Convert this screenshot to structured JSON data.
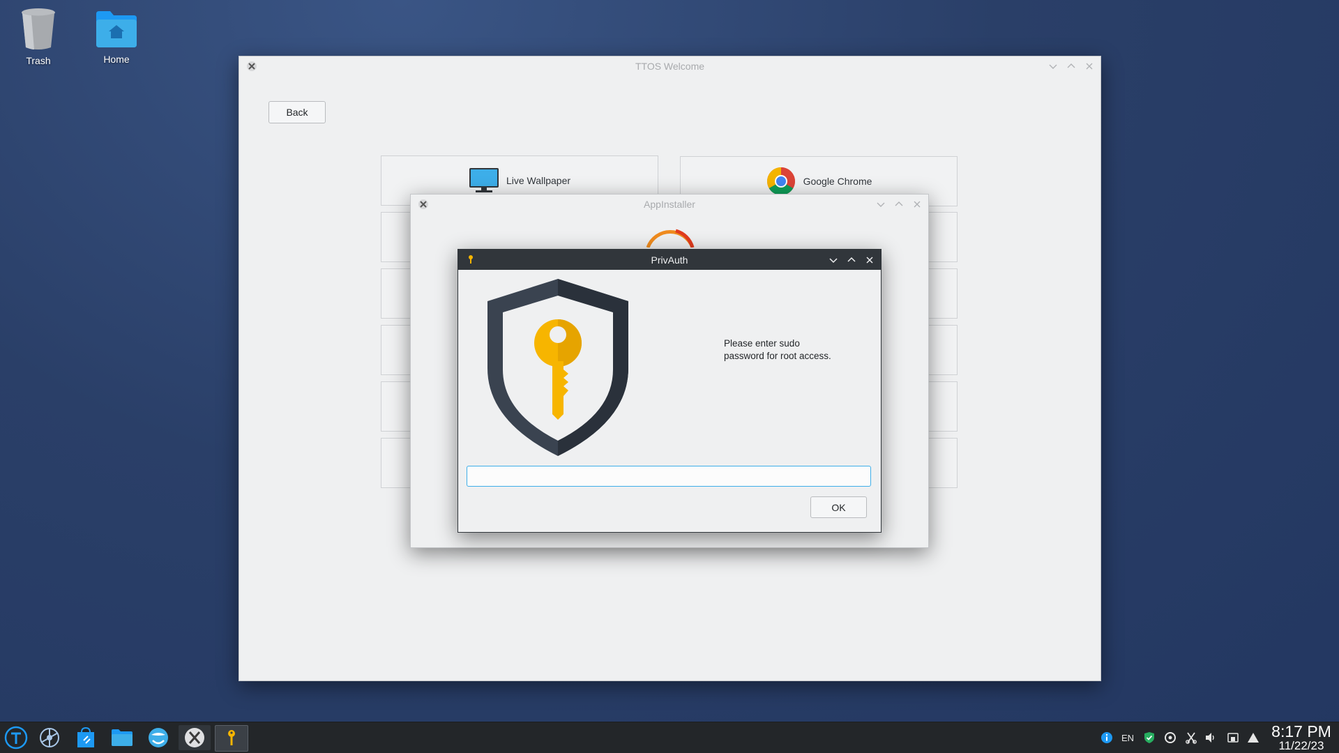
{
  "desktop": {
    "icons": [
      {
        "label": "Trash"
      },
      {
        "label": "Home"
      }
    ]
  },
  "welcome": {
    "title": "TTOS Welcome",
    "back_label": "Back",
    "cards": [
      {
        "label": "Live Wallpaper",
        "icon": "monitor-icon"
      },
      {
        "label": "Google Chrome",
        "icon": "chrome-icon"
      }
    ]
  },
  "appinstaller": {
    "title": "AppInstaller"
  },
  "privauth": {
    "title": "PrivAuth",
    "message_line1": "Please enter sudo",
    "message_line2": "password for root access.",
    "password_value": "",
    "ok_label": "OK"
  },
  "taskbar": {
    "apps": [
      "start-menu-icon",
      "settings-wheel-icon",
      "app-store-icon",
      "files-folder-icon",
      "browser-icon",
      "x-app-icon",
      "key-auth-icon"
    ],
    "tray": {
      "language": "EN",
      "time": "8:17 PM",
      "date": "11/22/23"
    }
  },
  "colors": {
    "accent": "#3daee9",
    "titlebar_dark": "#31363b",
    "taskbar": "#232629",
    "key_gold": "#f7b500",
    "shield_dark": "#2b323c"
  }
}
